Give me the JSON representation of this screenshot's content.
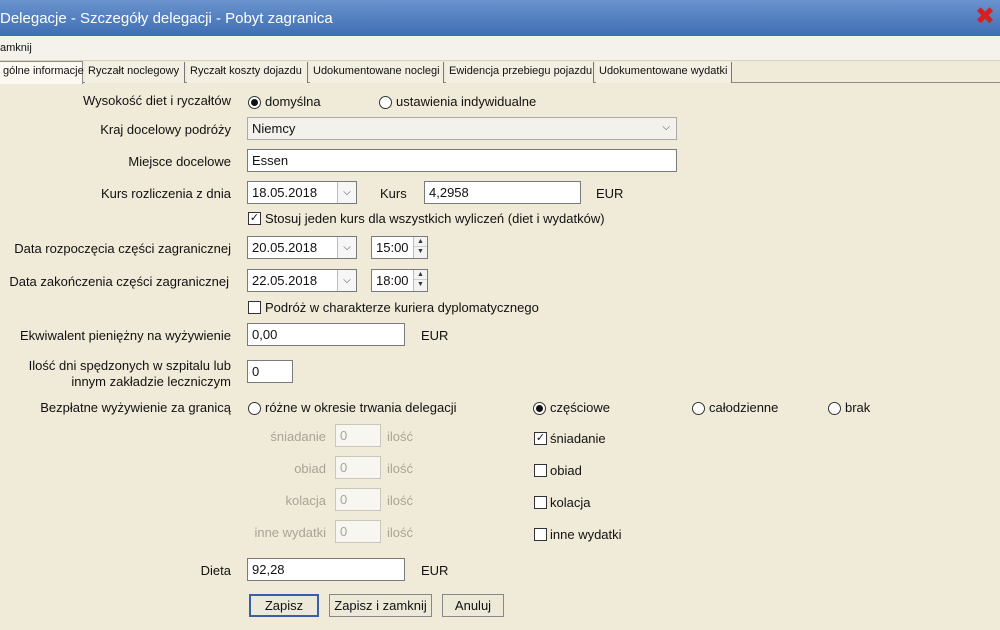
{
  "window": {
    "title": "Delegacje - Szczegóły delegacji - Pobyt zagranica",
    "close_glyph": "✖"
  },
  "menu": {
    "close_label": "amknij"
  },
  "tabs": [
    "gólne informacje",
    "Ryczałt noclegowy",
    "Ryczałt koszty dojazdu",
    "Udokumentowane noclegi",
    "Ewidencja przebiegu pojazdu",
    "Udokumentowane wydatki"
  ],
  "form": {
    "rates_label": "Wysokość diet i ryczałtów",
    "rates_opt_default": "domyślna",
    "rates_opt_individual": "ustawienia indywidualne",
    "country_label": "Kraj docelowy podróży",
    "country_value": "Niemcy",
    "place_label": "Miejsce docelowe",
    "place_value": "Essen",
    "rate_date_label": "Kurs rozliczenia z dnia",
    "rate_date_value": "18.05.2018",
    "rate_label": "Kurs",
    "rate_value": "4,2958",
    "rate_currency": "EUR",
    "single_rate_label": "Stosuj jeden kurs dla wszystkich wyliczeń (diet i wydatków)",
    "start_label": "Data rozpoczęcia części zagranicznej",
    "start_date": "20.05.2018",
    "start_time": "15:00",
    "end_label": "Data zakończenia części zagranicznej",
    "end_date": "22.05.2018",
    "end_time": "18:00",
    "courier_label": "Podróż w charakterze kuriera dyplomatycznego",
    "equiv_label": "Ekwiwalent pieniężny na wyżywienie",
    "equiv_value": "0,00",
    "equiv_currency": "EUR",
    "hospital_label_1": "Ilość dni spędzonych w szpitalu lub",
    "hospital_label_2": "innym zakładzie leczniczym",
    "hospital_value": "0",
    "meals_label": "Bezpłatne wyżywienie za granicą",
    "meals_opt_varied": "różne w okresie trwania delegacji",
    "meals_opt_partial": "częściowe",
    "meals_opt_full": "całodzienne",
    "meals_opt_none": "brak",
    "qty_label": "ilość",
    "meal_rows": [
      {
        "label": "śniadanie",
        "value": "0",
        "check_label": "śniadanie",
        "checked": true
      },
      {
        "label": "obiad",
        "value": "0",
        "check_label": "obiad",
        "checked": false
      },
      {
        "label": "kolacja",
        "value": "0",
        "check_label": "kolacja",
        "checked": false
      },
      {
        "label": "inne wydatki",
        "value": "0",
        "check_label": "inne wydatki",
        "checked": false
      }
    ],
    "diet_label": "Dieta",
    "diet_value": "92,28",
    "diet_currency": "EUR"
  },
  "buttons": {
    "save": "Zapisz",
    "save_close": "Zapisz i zamknij",
    "cancel": "Anuluj"
  }
}
